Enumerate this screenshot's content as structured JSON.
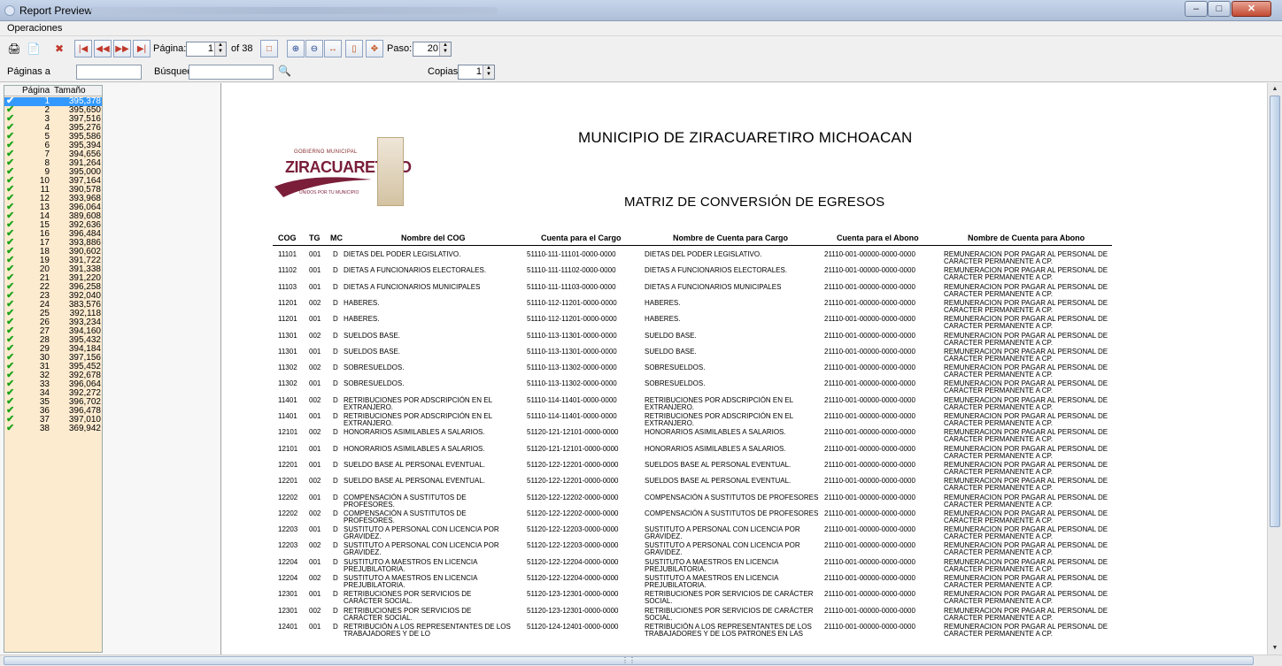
{
  "window": {
    "title": "Report Preview"
  },
  "menu": {
    "operaciones": "Operaciones"
  },
  "toolbar": {
    "pagina_label": "Página:",
    "pagina_value": "1",
    "of_label": "of 38",
    "paso_label": "Paso:",
    "paso_value": "20"
  },
  "searchbar": {
    "paginas_label": "Páginas a",
    "paginas_value": "",
    "busqueda_label": "Búsqued",
    "busqueda_value": "",
    "copias_label": "Copias:",
    "copias_value": "1"
  },
  "pagelist": {
    "header_page": "Página",
    "header_size": "Tamaño",
    "rows": [
      {
        "page": "1",
        "size": "395,378"
      },
      {
        "page": "2",
        "size": "395,650"
      },
      {
        "page": "3",
        "size": "397,516"
      },
      {
        "page": "4",
        "size": "395,276"
      },
      {
        "page": "5",
        "size": "395,586"
      },
      {
        "page": "6",
        "size": "395,394"
      },
      {
        "page": "7",
        "size": "394,656"
      },
      {
        "page": "8",
        "size": "391,264"
      },
      {
        "page": "9",
        "size": "395,000"
      },
      {
        "page": "10",
        "size": "397,164"
      },
      {
        "page": "11",
        "size": "390,578"
      },
      {
        "page": "12",
        "size": "393,968"
      },
      {
        "page": "13",
        "size": "396,064"
      },
      {
        "page": "14",
        "size": "389,608"
      },
      {
        "page": "15",
        "size": "392,636"
      },
      {
        "page": "16",
        "size": "396,484"
      },
      {
        "page": "17",
        "size": "393,886"
      },
      {
        "page": "18",
        "size": "390,602"
      },
      {
        "page": "19",
        "size": "391,722"
      },
      {
        "page": "20",
        "size": "391,338"
      },
      {
        "page": "21",
        "size": "391,220"
      },
      {
        "page": "22",
        "size": "396,258"
      },
      {
        "page": "23",
        "size": "392,040"
      },
      {
        "page": "24",
        "size": "383,576"
      },
      {
        "page": "25",
        "size": "392,118"
      },
      {
        "page": "26",
        "size": "393,234"
      },
      {
        "page": "27",
        "size": "394,160"
      },
      {
        "page": "28",
        "size": "395,432"
      },
      {
        "page": "29",
        "size": "394,184"
      },
      {
        "page": "30",
        "size": "397,156"
      },
      {
        "page": "31",
        "size": "395,452"
      },
      {
        "page": "32",
        "size": "392,678"
      },
      {
        "page": "33",
        "size": "396,064"
      },
      {
        "page": "34",
        "size": "392,272"
      },
      {
        "page": "35",
        "size": "396,702"
      },
      {
        "page": "36",
        "size": "396,478"
      },
      {
        "page": "37",
        "size": "397,010"
      },
      {
        "page": "38",
        "size": "369,942"
      }
    ]
  },
  "report": {
    "logo_small": "GOBIERNO MUNICIPAL",
    "logo_big": "ZIRACUARETIRO",
    "logo_tag": "UNIDOS POR TU MUNICIPIO",
    "title": "MUNICIPIO DE ZIRACUARETIRO MICHOACAN",
    "subtitle": "MATRIZ DE CONVERSIÓN DE EGRESOS",
    "columns": {
      "cog": "COG",
      "tg": "TG",
      "mc": "MC",
      "nombre": "Nombre del COG",
      "cargo": "Cuenta para el Cargo",
      "ncargo": "Nombre de Cuenta para Cargo",
      "abono": "Cuenta para el Abono",
      "nabono": "Nombre de Cuenta para Abono"
    },
    "rows": [
      {
        "cog": "11101",
        "tg": "001",
        "mc": "D",
        "nombre": "DIETAS DEL PODER LEGISLATIVO.",
        "cargo": "51110-111-11101-0000-0000",
        "ncargo": "DIETAS DEL PODER LEGISLATIVO.",
        "abono": "21110-001-00000-0000-0000",
        "nabono": "REMUNERACION POR PAGAR  AL PERSONAL DE CARACTER PERMANENTE A CP."
      },
      {
        "cog": "11102",
        "tg": "001",
        "mc": "D",
        "nombre": "DIETAS A FUNCIONARIOS ELECTORALES.",
        "cargo": "51110-111-11102-0000-0000",
        "ncargo": "DIETAS A FUNCIONARIOS ELECTORALES.",
        "abono": "21110-001-00000-0000-0000",
        "nabono": "REMUNERACION POR PAGAR  AL PERSONAL DE CARACTER PERMANENTE A CP."
      },
      {
        "cog": "11103",
        "tg": "001",
        "mc": "D",
        "nombre": "DIETAS A FUNCIONARIOS MUNICIPALES",
        "cargo": "51110-111-11103-0000-0000",
        "ncargo": "DIETAS A FUNCIONARIOS MUNICIPALES",
        "abono": "21110-001-00000-0000-0000",
        "nabono": "REMUNERACION POR PAGAR  AL PERSONAL DE CARACTER PERMANENTE A CP."
      },
      {
        "cog": "11201",
        "tg": "002",
        "mc": "D",
        "nombre": "HABERES.",
        "cargo": "51110-112-11201-0000-0000",
        "ncargo": "HABERES.",
        "abono": "21110-001-00000-0000-0000",
        "nabono": "REMUNERACION POR PAGAR  AL PERSONAL DE CARACTER PERMANENTE A CP."
      },
      {
        "cog": "11201",
        "tg": "001",
        "mc": "D",
        "nombre": "HABERES.",
        "cargo": "51110-112-11201-0000-0000",
        "ncargo": "HABERES.",
        "abono": "21110-001-00000-0000-0000",
        "nabono": "REMUNERACION POR PAGAR  AL PERSONAL DE CARACTER PERMANENTE A CP."
      },
      {
        "cog": "11301",
        "tg": "002",
        "mc": "D",
        "nombre": "SUELDOS BASE.",
        "cargo": "51110-113-11301-0000-0000",
        "ncargo": "SUELDO BASE.",
        "abono": "21110-001-00000-0000-0000",
        "nabono": "REMUNERACION POR PAGAR  AL PERSONAL DE CARACTER PERMANENTE A CP."
      },
      {
        "cog": "11301",
        "tg": "001",
        "mc": "D",
        "nombre": "SUELDOS BASE.",
        "cargo": "51110-113-11301-0000-0000",
        "ncargo": "SUELDO BASE.",
        "abono": "21110-001-00000-0000-0000",
        "nabono": "REMUNERACION POR PAGAR  AL PERSONAL DE CARACTER PERMANENTE A CP."
      },
      {
        "cog": "11302",
        "tg": "002",
        "mc": "D",
        "nombre": "SOBRESUELDOS.",
        "cargo": "51110-113-11302-0000-0000",
        "ncargo": "SOBRESUELDOS.",
        "abono": "21110-001-00000-0000-0000",
        "nabono": "REMUNERACION POR PAGAR  AL PERSONAL DE CARACTER PERMANENTE A CP."
      },
      {
        "cog": "11302",
        "tg": "001",
        "mc": "D",
        "nombre": "SOBRESUELDOS.",
        "cargo": "51110-113-11302-0000-0000",
        "ncargo": "SOBRESUELDOS.",
        "abono": "21110-001-00000-0000-0000",
        "nabono": "REMUNERACION POR PAGAR  AL PERSONAL DE CARACTER PERMANENTE A CP."
      },
      {
        "cog": "11401",
        "tg": "002",
        "mc": "D",
        "nombre": "RETRIBUCIONES POR ADSCRIPCIÓN EN EL EXTRANJERO.",
        "cargo": "51110-114-11401-0000-0000",
        "ncargo": "RETRIBUCIONES POR ADSCRIPCIÓN EN EL EXTRANJERO.",
        "abono": "21110-001-00000-0000-0000",
        "nabono": "REMUNERACION POR PAGAR  AL PERSONAL DE CARACTER PERMANENTE A CP."
      },
      {
        "cog": "11401",
        "tg": "001",
        "mc": "D",
        "nombre": "RETRIBUCIONES POR ADSCRIPCIÓN EN EL EXTRANJERO.",
        "cargo": "51110-114-11401-0000-0000",
        "ncargo": "RETRIBUCIONES POR ADSCRIPCIÓN EN EL EXTRANJERO.",
        "abono": "21110-001-00000-0000-0000",
        "nabono": "REMUNERACION POR PAGAR  AL PERSONAL DE CARACTER PERMANENTE A CP."
      },
      {
        "cog": "12101",
        "tg": "002",
        "mc": "D",
        "nombre": "HONORARIOS ASIMILABLES A SALARIOS.",
        "cargo": "51120-121-12101-0000-0000",
        "ncargo": "HONORARIOS ASIMILABLES A SALARIOS.",
        "abono": "21110-001-00000-0000-0000",
        "nabono": "REMUNERACION POR PAGAR  AL PERSONAL DE CARACTER PERMANENTE A CP."
      },
      {
        "cog": "12101",
        "tg": "001",
        "mc": "D",
        "nombre": "HONORARIOS ASIMILABLES A SALARIOS.",
        "cargo": "51120-121-12101-0000-0000",
        "ncargo": "HONORARIOS ASIMILABLES A SALARIOS.",
        "abono": "21110-001-00000-0000-0000",
        "nabono": "REMUNERACION POR PAGAR  AL PERSONAL DE CARACTER PERMANENTE A CP."
      },
      {
        "cog": "12201",
        "tg": "001",
        "mc": "D",
        "nombre": "SUELDO BASE AL PERSONAL EVENTUAL.",
        "cargo": "51120-122-12201-0000-0000",
        "ncargo": "SUELDOS BASE AL PERSONAL EVENTUAL.",
        "abono": "21110-001-00000-0000-0000",
        "nabono": "REMUNERACION POR PAGAR  AL PERSONAL DE CARACTER PERMANENTE A CP."
      },
      {
        "cog": "12201",
        "tg": "002",
        "mc": "D",
        "nombre": "SUELDO BASE AL PERSONAL EVENTUAL.",
        "cargo": "51120-122-12201-0000-0000",
        "ncargo": "SUELDOS BASE AL PERSONAL EVENTUAL.",
        "abono": "21110-001-00000-0000-0000",
        "nabono": "REMUNERACION POR PAGAR  AL PERSONAL DE CARACTER PERMANENTE A CP."
      },
      {
        "cog": "12202",
        "tg": "001",
        "mc": "D",
        "nombre": "COMPENSACIÓN A SUSTITUTOS DE PROFESORES.",
        "cargo": "51120-122-12202-0000-0000",
        "ncargo": "COMPENSACIÓN A SUSTITUTOS DE PROFESORES",
        "abono": "21110-001-00000-0000-0000",
        "nabono": "REMUNERACION POR PAGAR  AL PERSONAL DE CARACTER PERMANENTE A CP."
      },
      {
        "cog": "12202",
        "tg": "002",
        "mc": "D",
        "nombre": "COMPENSACIÓN A SUSTITUTOS DE PROFESORES.",
        "cargo": "51120-122-12202-0000-0000",
        "ncargo": "COMPENSACIÓN A SUSTITUTOS DE PROFESORES",
        "abono": "21110-001-00000-0000-0000",
        "nabono": "REMUNERACION POR PAGAR  AL PERSONAL DE CARACTER PERMANENTE A CP."
      },
      {
        "cog": "12203",
        "tg": "001",
        "mc": "D",
        "nombre": "SUSTITUTO A PERSONAL CON LICENCIA POR GRAVIDEZ.",
        "cargo": "51120-122-12203-0000-0000",
        "ncargo": "SUSTITUTO A PERSONAL CON LICENCIA POR GRAVIDEZ.",
        "abono": "21110-001-00000-0000-0000",
        "nabono": "REMUNERACION POR PAGAR  AL PERSONAL DE CARACTER PERMANENTE A CP."
      },
      {
        "cog": "12203",
        "tg": "002",
        "mc": "D",
        "nombre": "SUSTITUTO A PERSONAL CON LICENCIA POR GRAVIDEZ.",
        "cargo": "51120-122-12203-0000-0000",
        "ncargo": "SUSTITUTO A PERSONAL CON LICENCIA POR GRAVIDEZ.",
        "abono": "21110-001-00000-0000-0000",
        "nabono": "REMUNERACION POR PAGAR  AL PERSONAL DE CARACTER PERMANENTE A CP."
      },
      {
        "cog": "12204",
        "tg": "001",
        "mc": "D",
        "nombre": "SUSTITUTO A MAESTROS EN LICENCIA PREJUBILATORIA.",
        "cargo": "51120-122-12204-0000-0000",
        "ncargo": "SUSTITUTO A MAESTROS EN LICENCIA PREJUBILATORIA.",
        "abono": "21110-001-00000-0000-0000",
        "nabono": "REMUNERACION POR PAGAR  AL PERSONAL DE CARACTER PERMANENTE A CP."
      },
      {
        "cog": "12204",
        "tg": "002",
        "mc": "D",
        "nombre": "SUSTITUTO A MAESTROS EN LICENCIA PREJUBILATORIA.",
        "cargo": "51120-122-12204-0000-0000",
        "ncargo": "SUSTITUTO A MAESTROS EN LICENCIA PREJUBILATORIA.",
        "abono": "21110-001-00000-0000-0000",
        "nabono": "REMUNERACION POR PAGAR  AL PERSONAL DE CARACTER PERMANENTE A CP."
      },
      {
        "cog": "12301",
        "tg": "001",
        "mc": "D",
        "nombre": "RETRIBUCIONES POR SERVICIOS DE CARÁCTER SOCIAL.",
        "cargo": "51120-123-12301-0000-0000",
        "ncargo": "RETRIBUCIONES POR SERVICIOS DE CARÁCTER SOCIAL.",
        "abono": "21110-001-00000-0000-0000",
        "nabono": "REMUNERACION POR PAGAR  AL PERSONAL DE CARACTER PERMANENTE A CP."
      },
      {
        "cog": "12301",
        "tg": "002",
        "mc": "D",
        "nombre": "RETRIBUCIONES POR SERVICIOS DE CARÁCTER SOCIAL.",
        "cargo": "51120-123-12301-0000-0000",
        "ncargo": "RETRIBUCIONES POR SERVICIOS DE CARÁCTER SOCIAL.",
        "abono": "21110-001-00000-0000-0000",
        "nabono": "REMUNERACION POR PAGAR  AL PERSONAL DE CARACTER PERMANENTE A CP."
      },
      {
        "cog": "12401",
        "tg": "001",
        "mc": "D",
        "nombre": "RETRIBUCIÓN A LOS REPRESENTANTES DE LOS TRABAJADORES Y DE LO",
        "cargo": "51120-124-12401-0000-0000",
        "ncargo": "RETRIBUCIÓN A LOS REPRESENTANTES DE LOS TRABAJADORES Y DE LOS PATRONES EN LAS",
        "abono": "21110-001-00000-0000-0000",
        "nabono": "REMUNERACION POR PAGAR  AL PERSONAL DE CARACTER PERMANENTE A CP."
      }
    ]
  }
}
